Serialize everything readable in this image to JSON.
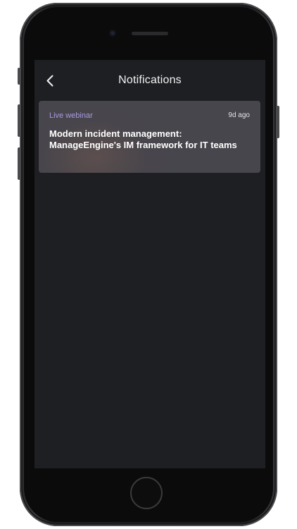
{
  "screen": {
    "title": "Notifications",
    "back_icon": "chevron-left-icon"
  },
  "notifications": [
    {
      "tag": "Live webinar",
      "time": "9d ago",
      "title": "Modern incident management: ManageEngine's IM framework for IT teams"
    }
  ],
  "colors": {
    "screen_background": "#1e1f22",
    "card_background": "#46464c",
    "tag_color": "#a99ae0",
    "title_color": "#ffffff"
  }
}
